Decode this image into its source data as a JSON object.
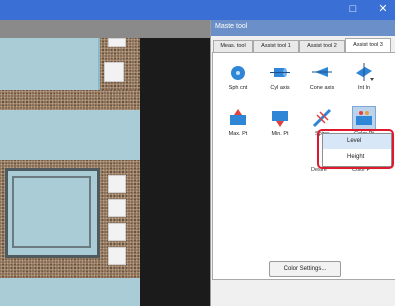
{
  "window": {
    "restore_glyph": "□",
    "close_glyph": "✕"
  },
  "panel": {
    "title": "Maste tool",
    "tabs": [
      {
        "label": "Meas. tool"
      },
      {
        "label": "Assist tool 1"
      },
      {
        "label": "Assist tool 2"
      },
      {
        "label": "Assist tool 3"
      }
    ],
    "tools_row1": [
      {
        "label": "Sph cnt",
        "icon": "sphere-center-icon"
      },
      {
        "label": "Cyl axis",
        "icon": "cylinder-axis-icon"
      },
      {
        "label": "Cone axis",
        "icon": "cone-axis-icon"
      },
      {
        "label": "Int ln",
        "icon": "intersection-line-icon"
      }
    ],
    "tools_row2": [
      {
        "label": "Max. Pt",
        "icon": "max-point-icon"
      },
      {
        "label": "Min. Pt",
        "icon": "min-point-icon"
      },
      {
        "label": "Spine",
        "icon": "spine-icon"
      },
      {
        "label": "Color Pt",
        "icon": "color-point-icon"
      }
    ],
    "partial_labels": [
      "Desire",
      "Color P"
    ],
    "menu": {
      "items": [
        "Level",
        "Height"
      ]
    },
    "color_settings_label": "Color Settings..."
  },
  "colors": {
    "title_bar": "#3a6fd6",
    "highlight_frame": "#e0182d"
  }
}
